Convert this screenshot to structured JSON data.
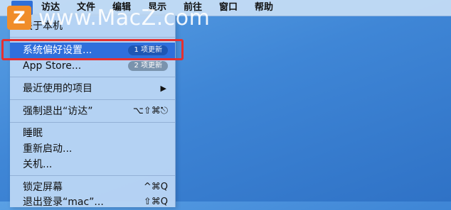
{
  "menubar": {
    "apple_icon": "apple-icon",
    "items": [
      "访达",
      "文件",
      "编辑",
      "显示",
      "前往",
      "窗口",
      "帮助"
    ]
  },
  "watermark": {
    "logo_letter": "Z",
    "text": "www.MacZ.com"
  },
  "apple_menu": {
    "about": "关于本机",
    "system_prefs": {
      "label": "系统偏好设置...",
      "badge": "1 项更新"
    },
    "app_store": {
      "label": "App Store...",
      "badge": "2 项更新"
    },
    "recent": {
      "label": "最近使用的项目"
    },
    "force_quit": {
      "label": "强制退出“访达”",
      "shortcut": "⌥⇧⌘⎋"
    },
    "sleep": "睡眠",
    "restart": "重新启动...",
    "shutdown": "关机...",
    "lock": {
      "label": "锁定屏幕",
      "shortcut": "^⌘Q"
    },
    "logout": {
      "label": "退出登录“mac”...",
      "shortcut": "⇧⌘Q"
    }
  },
  "colors": {
    "selection": "#2f6fdc",
    "highlight_border": "#e53030",
    "watermark_logo": "#f08d2a"
  }
}
